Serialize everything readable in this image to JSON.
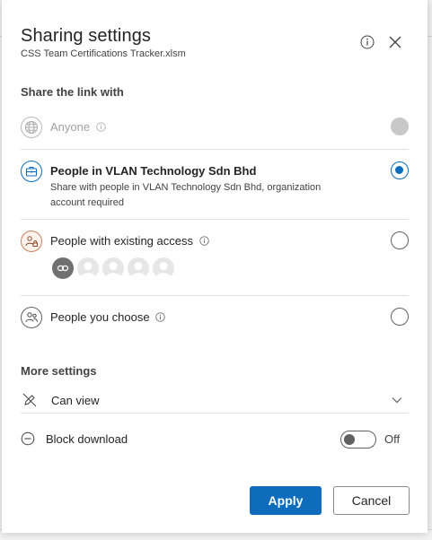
{
  "dialog": {
    "title": "Sharing settings",
    "subtitle": "CSS Team Certifications Tracker.xlsm"
  },
  "share_section": {
    "label": "Share the link with",
    "options": [
      {
        "title": "Anyone",
        "description": "",
        "selected": false,
        "disabled": true,
        "icon": "globe-icon"
      },
      {
        "title": "People in VLAN Technology Sdn Bhd",
        "description": "Share with people in VLAN Technology Sdn Bhd, organization account required",
        "selected": true,
        "disabled": false,
        "icon": "organization-icon"
      },
      {
        "title": "People with existing access",
        "description": "",
        "selected": false,
        "disabled": false,
        "icon": "people-lock-icon"
      },
      {
        "title": "People you choose",
        "description": "",
        "selected": false,
        "disabled": false,
        "icon": "people-choose-icon"
      }
    ]
  },
  "more_settings": {
    "label": "More settings",
    "permission": {
      "value": "Can view",
      "icon": "pencil-off-icon"
    },
    "block_download": {
      "label": "Block download",
      "toggle_state": "Off",
      "icon": "block-icon"
    }
  },
  "buttons": {
    "apply": "Apply",
    "cancel": "Cancel"
  },
  "colors": {
    "accent": "#0f6cbd",
    "text": "#242424",
    "divider": "#e1e1e1"
  }
}
